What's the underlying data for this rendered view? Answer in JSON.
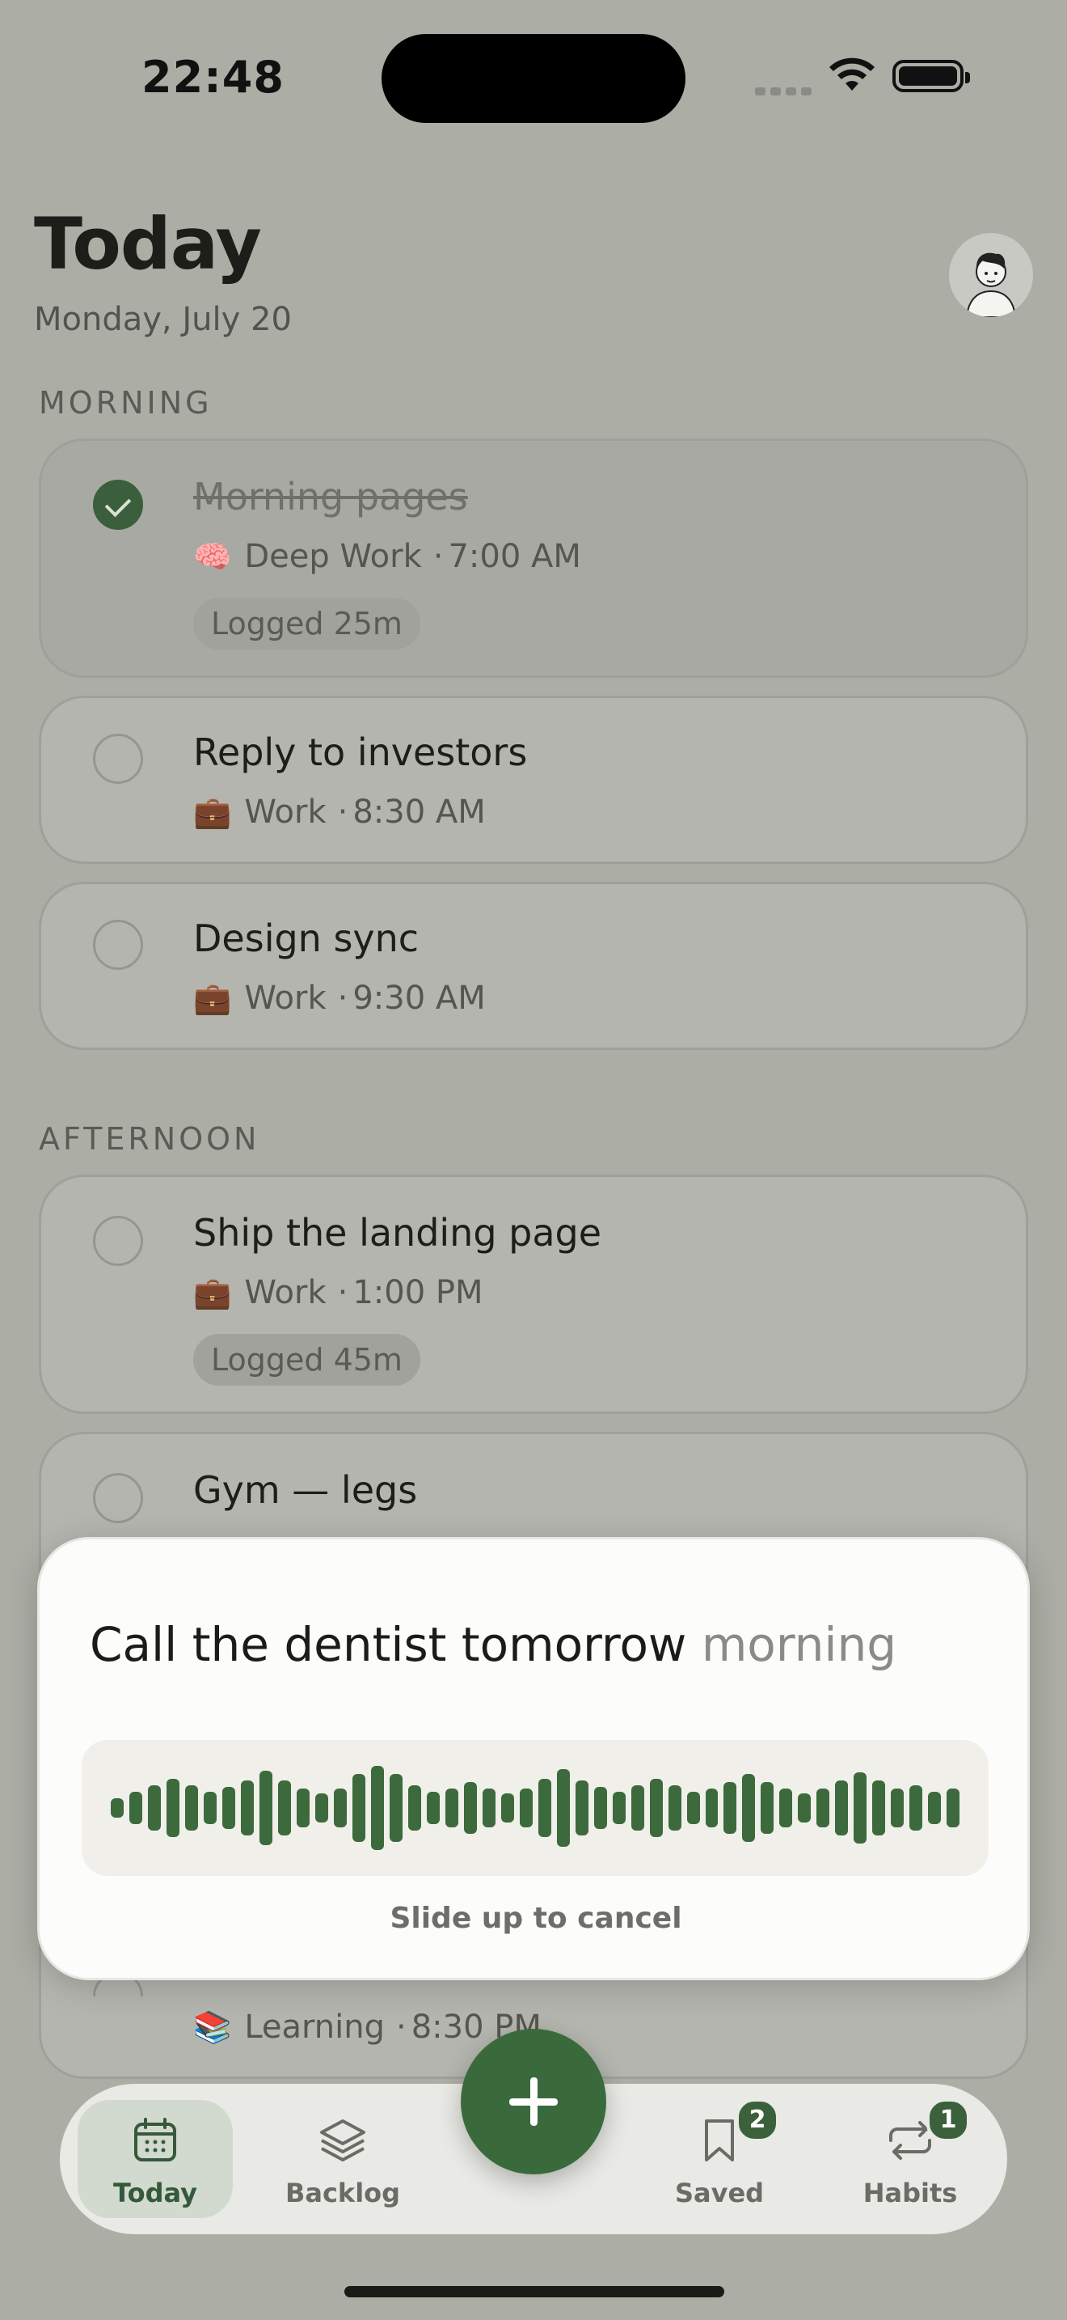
{
  "status_bar": {
    "time": "22:48"
  },
  "header": {
    "title": "Today",
    "date": "Monday, July 20"
  },
  "sections": [
    {
      "label": "MORNING",
      "tasks": [
        {
          "title": "Morning pages",
          "category": "Deep Work",
          "category_icon": "brain-icon",
          "time": "7:00 AM",
          "completed": true,
          "logged": "Logged 25m"
        },
        {
          "title": "Reply to investors",
          "category": "Work",
          "category_icon": "briefcase-icon",
          "time": "8:30 AM",
          "completed": false
        },
        {
          "title": "Design sync",
          "category": "Work",
          "category_icon": "briefcase-icon",
          "time": "9:30 AM",
          "completed": false
        }
      ]
    },
    {
      "label": "AFTERNOON",
      "tasks": [
        {
          "title": "Ship the landing page",
          "category": "Work",
          "category_icon": "briefcase-icon",
          "time": "1:00 PM",
          "completed": false,
          "logged": "Logged 45m"
        },
        {
          "title": "Gym — legs",
          "completed": false
        }
      ]
    },
    {
      "label": "",
      "tasks": [
        {
          "category": "Learning",
          "category_icon": "books-icon",
          "time": "8:30 PM",
          "completed": false
        }
      ]
    }
  ],
  "voice_input": {
    "transcript": "Call the dentist tomorrow",
    "pending_word": "morning",
    "hint": "Slide up to cancel",
    "accent_color": "#3c6a3c"
  },
  "tab_bar": {
    "tabs": [
      {
        "label": "Today",
        "icon": "calendar-icon",
        "active": true
      },
      {
        "label": "Backlog",
        "icon": "layers-icon",
        "active": false
      },
      {
        "label": "Saved",
        "icon": "bookmark-icon",
        "badge": "2",
        "active": false
      },
      {
        "label": "Habits",
        "icon": "repeat-icon",
        "badge": "1",
        "active": false
      }
    ],
    "fab_icon": "plus-icon"
  },
  "colors": {
    "accent": "#3b613c",
    "background": "#acada5"
  }
}
